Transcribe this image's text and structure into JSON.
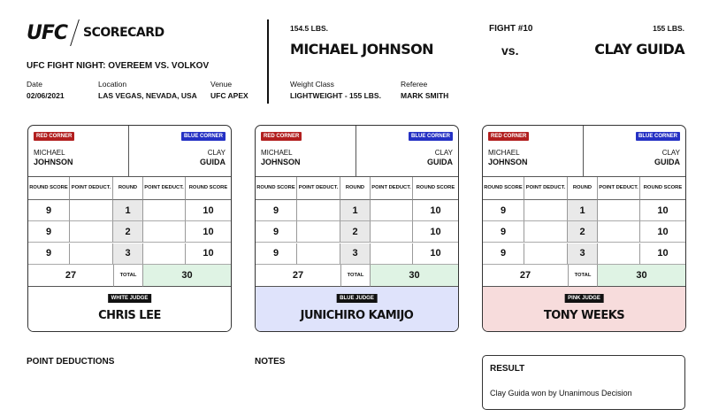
{
  "header": {
    "logo": "UFC",
    "title": "SCORECARD",
    "event": "UFC FIGHT NIGHT: OVEREEM VS. VOLKOV",
    "date_label": "Date",
    "date": "02/06/2021",
    "location_label": "Location",
    "location": "LAS VEGAS, NEVADA, USA",
    "venue_label": "Venue",
    "venue": "UFC APEX"
  },
  "fight": {
    "red_weight": "154.5 LBS.",
    "red_name": "MICHAEL JOHNSON",
    "fight_number": "FIGHT #10",
    "vs": "vs.",
    "blue_weight": "155 LBS.",
    "blue_name": "CLAY GUIDA",
    "weight_class_label": "Weight Class",
    "weight_class": "LIGHTWEIGHT - 155 LBS.",
    "referee_label": "Referee",
    "referee": "MARK SMITH"
  },
  "columns": {
    "round_score": "ROUND SCORE",
    "point_deduct": "POINT DEDUCT.",
    "round": "ROUND",
    "total": "TOTAL"
  },
  "corners": {
    "red_label": "RED CORNER",
    "blue_label": "BLUE CORNER",
    "red_first": "MICHAEL",
    "red_last": "JOHNSON",
    "blue_first": "CLAY",
    "blue_last": "GUIDA"
  },
  "cards": [
    {
      "judge_tag": "WHITE JUDGE",
      "judge_name": "CHRIS LEE",
      "color": "#ffffff",
      "rounds": [
        {
          "red": "9",
          "round": "1",
          "blue": "10"
        },
        {
          "red": "9",
          "round": "2",
          "blue": "10"
        },
        {
          "red": "9",
          "round": "3",
          "blue": "10"
        }
      ],
      "red_total": "27",
      "blue_total": "30"
    },
    {
      "judge_tag": "BLUE JUDGE",
      "judge_name": "JUNICHIRO KAMIJO",
      "color": "#dfe3fb",
      "rounds": [
        {
          "red": "9",
          "round": "1",
          "blue": "10"
        },
        {
          "red": "9",
          "round": "2",
          "blue": "10"
        },
        {
          "red": "9",
          "round": "3",
          "blue": "10"
        }
      ],
      "red_total": "27",
      "blue_total": "30"
    },
    {
      "judge_tag": "PINK JUDGE",
      "judge_name": "TONY WEEKS",
      "color": "#f7dcdc",
      "rounds": [
        {
          "red": "9",
          "round": "1",
          "blue": "10"
        },
        {
          "red": "9",
          "round": "2",
          "blue": "10"
        },
        {
          "red": "9",
          "round": "3",
          "blue": "10"
        }
      ],
      "red_total": "27",
      "blue_total": "30"
    }
  ],
  "footer": {
    "point_deductions": "POINT DEDUCTIONS",
    "notes": "NOTES",
    "result_title": "RESULT",
    "result_text": "Clay Guida won by Unanimous Decision"
  }
}
